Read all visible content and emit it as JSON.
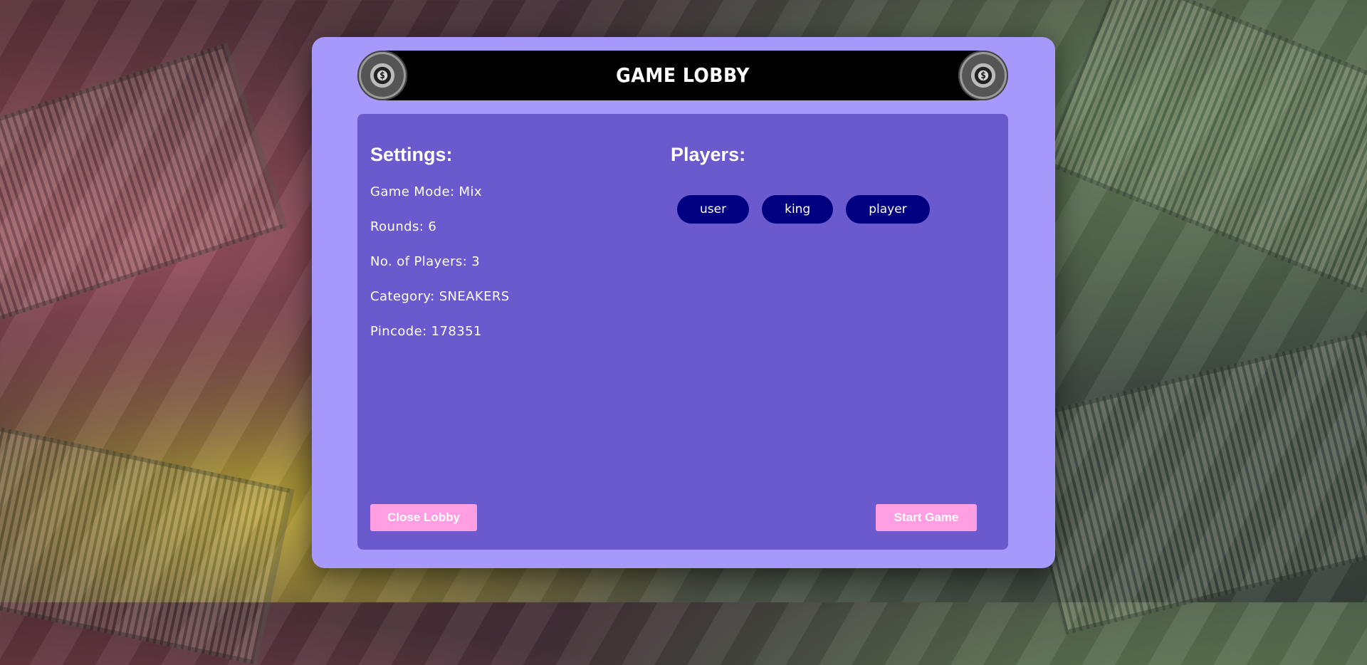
{
  "header": {
    "title": "GAME LOBBY",
    "left_icon": "poker-chip-icon",
    "right_icon": "poker-chip-icon",
    "chip_label": "$"
  },
  "settings": {
    "heading": "Settings:",
    "game_mode": "Game Mode: Mix",
    "rounds": "Rounds: 6",
    "num_players": "No. of Players: 3",
    "category": "Category: SNEAKERS",
    "pincode": "Pincode: 178351"
  },
  "players": {
    "heading": "Players:",
    "list": [
      "user",
      "king",
      "player"
    ]
  },
  "actions": {
    "close_label": "Close Lobby",
    "start_label": "Start Game"
  },
  "colors": {
    "panel": "#a798fb",
    "content": "#6a5acd",
    "player_tag": "#010080",
    "button": "#ff9ee2"
  }
}
